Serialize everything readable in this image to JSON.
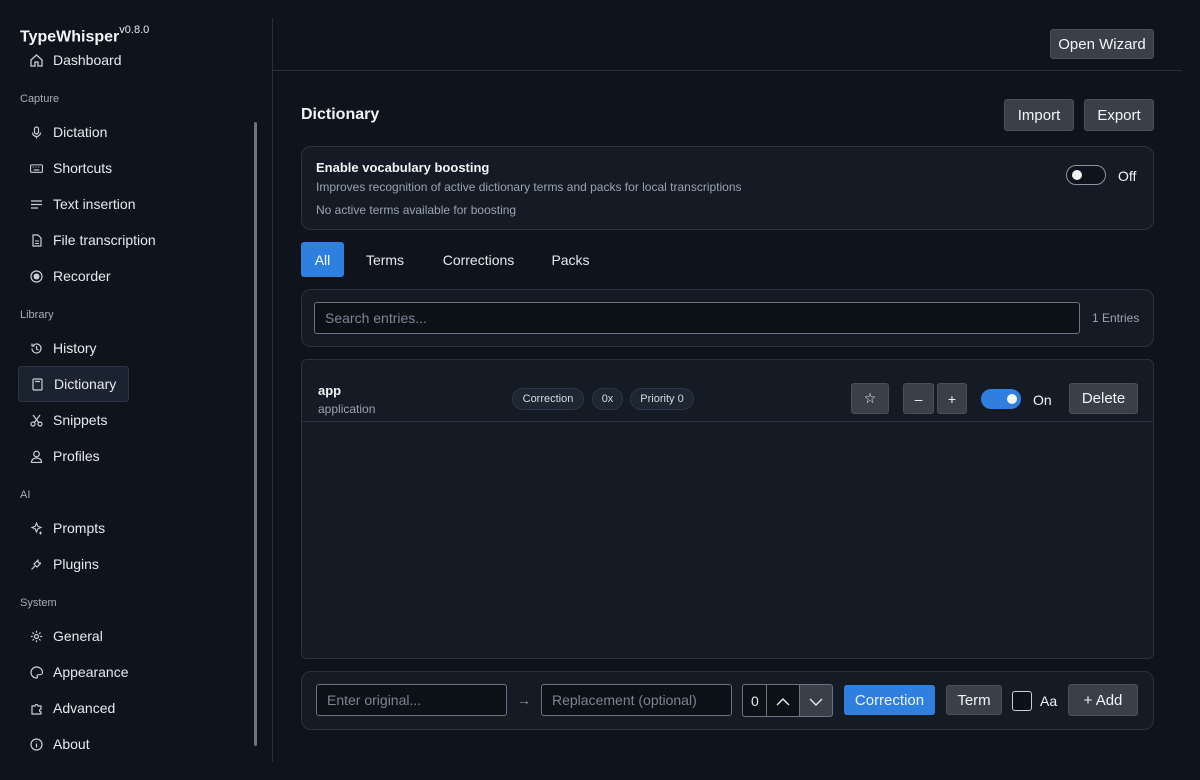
{
  "app": {
    "name": "TypeWhisper",
    "version": "v0.8.0"
  },
  "sidebar": {
    "sections": [
      {
        "label": "Capture"
      },
      {
        "label": "Library"
      },
      {
        "label": "AI"
      },
      {
        "label": "System"
      }
    ],
    "items": [
      {
        "label": "Dashboard",
        "icon": "dashboard-icon"
      },
      {
        "label": "Dictation",
        "icon": "microphone-icon"
      },
      {
        "label": "Shortcuts",
        "icon": "keyboard-icon"
      },
      {
        "label": "Text insertion",
        "icon": "text-lines-icon"
      },
      {
        "label": "File transcription",
        "icon": "file-icon"
      },
      {
        "label": "Recorder",
        "icon": "record-icon"
      },
      {
        "label": "History",
        "icon": "history-icon"
      },
      {
        "label": "Dictionary",
        "icon": "book-icon",
        "active": true
      },
      {
        "label": "Snippets",
        "icon": "scissors-icon"
      },
      {
        "label": "Profiles",
        "icon": "person-icon"
      },
      {
        "label": "Prompts",
        "icon": "sparkle-icon"
      },
      {
        "label": "Plugins",
        "icon": "plug-icon"
      },
      {
        "label": "General",
        "icon": "gear-icon"
      },
      {
        "label": "Appearance",
        "icon": "palette-icon"
      },
      {
        "label": "Advanced",
        "icon": "puzzle-icon"
      },
      {
        "label": "About",
        "icon": "info-icon"
      }
    ]
  },
  "header": {
    "open_wizard_label": "Open Wizard"
  },
  "page": {
    "title": "Dictionary",
    "import_label": "Import",
    "export_label": "Export"
  },
  "boosting": {
    "title": "Enable vocabulary boosting",
    "description": "Improves recognition of active dictionary terms and packs for local transcriptions",
    "status": "No active terms available for boosting",
    "toggle_label": "Off",
    "enabled": false
  },
  "tabs": [
    {
      "label": "All",
      "active": true
    },
    {
      "label": "Terms"
    },
    {
      "label": "Corrections"
    },
    {
      "label": "Packs"
    }
  ],
  "search": {
    "placeholder": "Search entries...",
    "value": "",
    "count_label": "1 Entries"
  },
  "entries": [
    {
      "original": "app",
      "replacement": "application",
      "type_badge": "Correction",
      "usage_badge": "0x",
      "priority_badge": "Priority 0",
      "star_label": "☆",
      "minus_label": "–",
      "plus_label": "+",
      "toggle_label": "On",
      "enabled": true,
      "delete_label": "Delete"
    }
  ],
  "add_form": {
    "original_placeholder": "Enter original...",
    "arrow": "→",
    "replacement_placeholder": "Replacement (optional)",
    "priority_value": "0",
    "correction_label": "Correction",
    "term_label": "Term",
    "case_label": "Aa",
    "add_label": "+ Add"
  },
  "colors": {
    "accent": "#2f7fe0",
    "background": "#0f141c",
    "panel": "#151b24"
  }
}
